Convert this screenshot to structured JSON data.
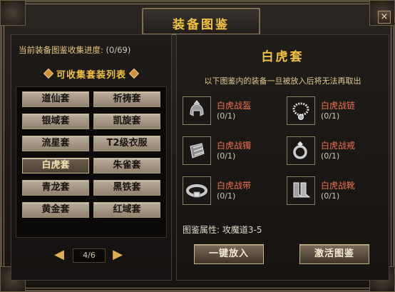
{
  "window": {
    "title": "装备图鉴",
    "close_label": "×"
  },
  "left": {
    "progress_label": "当前装备图鉴收集进度:",
    "progress_value": "(0/69)",
    "list_title": "可收集套装列表",
    "sets": [
      "道仙套",
      "祈祷套",
      "银域套",
      "凯旋套",
      "流星套",
      "T2级衣服",
      "白虎套",
      "朱雀套",
      "青龙套",
      "黑铁套",
      "黄金套",
      "红域套"
    ],
    "selected_set": "白虎套",
    "pager": {
      "prev": "◀",
      "next": "▶",
      "page": "4/6"
    }
  },
  "right": {
    "set_title": "白虎套",
    "notice": "以下图鉴内的装备一旦被放入后将无法再取出",
    "items": [
      {
        "name": "白虎战盔",
        "count": "(0/1)",
        "icon": "helmet-icon"
      },
      {
        "name": "白虎战链",
        "count": "(0/1)",
        "icon": "necklace-icon"
      },
      {
        "name": "白虎战镯",
        "count": "(0/1)",
        "icon": "bracelet-icon"
      },
      {
        "name": "白虎战戒",
        "count": "(0/1)",
        "icon": "ring-icon"
      },
      {
        "name": "白虎战带",
        "count": "(0/1)",
        "icon": "belt-icon"
      },
      {
        "name": "白虎战靴",
        "count": "(0/1)",
        "icon": "boots-icon"
      }
    ],
    "attribute": "图鉴属性: 攻魔道3-5",
    "buttons": {
      "put_all": "一键放入",
      "activate": "激活图鉴"
    }
  },
  "colors": {
    "gold": "#f0c040",
    "item_name": "#f07050",
    "frame": "#5b5040"
  }
}
